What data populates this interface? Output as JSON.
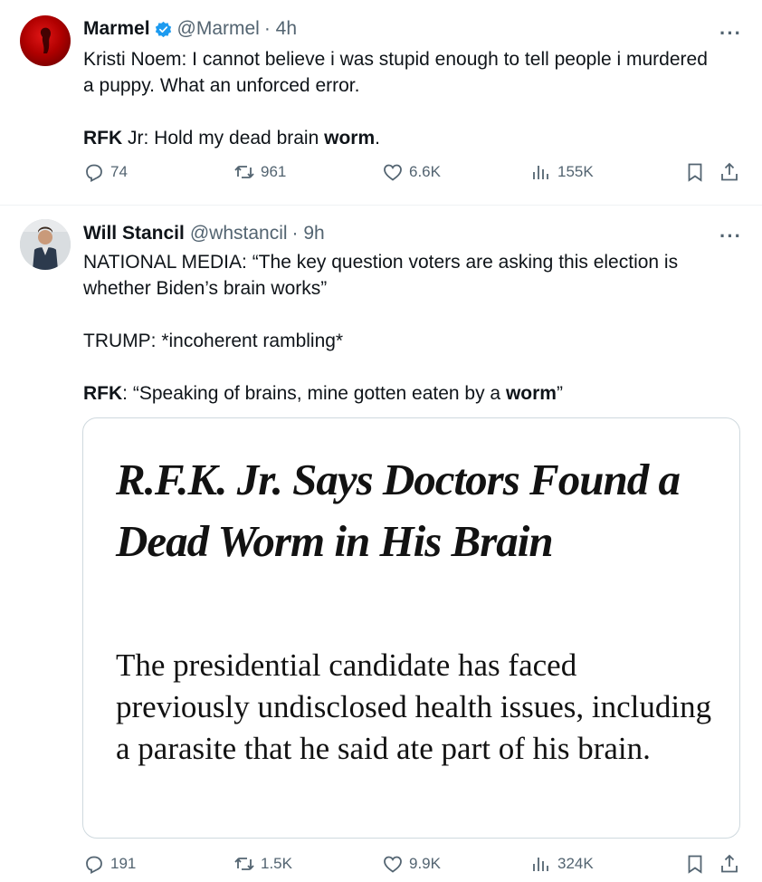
{
  "tweets": [
    {
      "name": "Marmel",
      "handle": "@Marmel",
      "time": "· 4h",
      "more": "···",
      "text_lines": [
        "Kristi Noem: I cannot believe i was stupid enough to tell people i murdered",
        "a puppy. What an unforced error."
      ],
      "line2_prefix_bold": "RFK",
      "line2_middle": " Jr: Hold my dead brain ",
      "line2_suffix_bold": "worm",
      "line2_end": ".",
      "replies": "74",
      "reposts": "961",
      "likes": "6.6K",
      "views": "155K"
    },
    {
      "name": "Will Stancil",
      "handle": "@whstancil",
      "time": "· 9h",
      "more": "···",
      "para1": [
        "NATIONAL MEDIA: “The key question voters are asking this election is",
        "whether Biden’s brain works”"
      ],
      "para2": "TRUMP: *incoherent rambling*",
      "para3_bold1": "RFK",
      "para3_middle": ": “Speaking of brains, mine gotten eaten by a ",
      "para3_bold2": "worm",
      "para3_end": "”",
      "card": {
        "headline": "R.F.K. Jr. Says Doctors Found a Dead Worm in His Brain",
        "subhead": "The presidential candidate has faced previously undisclosed health issues, including a parasite that he said ate part of his brain."
      },
      "replies": "191",
      "reposts": "1.5K",
      "likes": "9.9K",
      "views": "324K"
    }
  ],
  "colors": {
    "text": "#0f1419",
    "secondary": "#536471",
    "verified_blue": "#1d9bf0",
    "divider": "#eff3f4",
    "card_border": "#cfd9de"
  },
  "icons": [
    "verified-badge-icon",
    "more-icon",
    "reply-icon",
    "repost-icon",
    "like-icon",
    "views-icon",
    "bookmark-icon",
    "share-icon"
  ]
}
